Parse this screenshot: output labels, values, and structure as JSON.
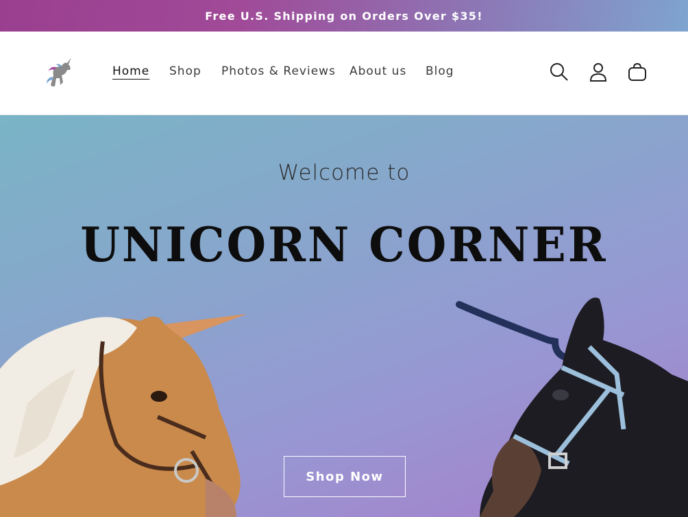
{
  "announcement": "Free U.S. Shipping on Orders Over $35!",
  "nav": {
    "items": [
      {
        "label": "Home",
        "active": true
      },
      {
        "label": "Shop"
      },
      {
        "label": "Photos & Reviews"
      },
      {
        "label": "About us"
      },
      {
        "label": "Blog"
      }
    ]
  },
  "header_icons": [
    "search-icon",
    "account-icon",
    "cart-icon"
  ],
  "hero": {
    "welcome": "Welcome to",
    "brand": "UNICORN CORNER",
    "button": "Shop Now"
  },
  "colors": {
    "announce_start": "#9a3f8f",
    "announce_end": "#7ea4cf",
    "hero_start": "#7ab4c6",
    "hero_end": "#a77fca"
  }
}
